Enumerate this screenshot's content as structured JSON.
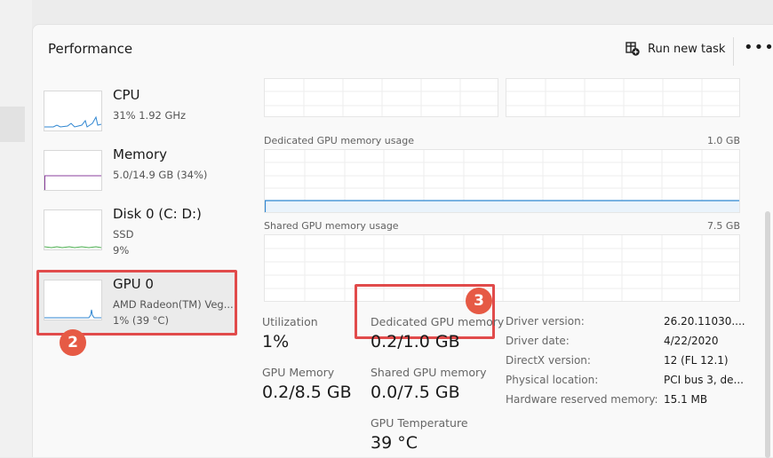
{
  "header": {
    "title": "Performance",
    "run_task_label": "Run new task",
    "more_label": "•••"
  },
  "sidebar": {
    "items": [
      {
        "title": "CPU",
        "line1": "31%  1.92 GHz",
        "line2": ""
      },
      {
        "title": "Memory",
        "line1": "5.0/14.9 GB (34%)",
        "line2": ""
      },
      {
        "title": "Disk 0 (C: D:)",
        "line1": "SSD",
        "line2": "9%"
      },
      {
        "title": "GPU 0",
        "line1": "AMD Radeon(TM) Veg...",
        "line2": "1% (39 °C)"
      }
    ]
  },
  "annotations": {
    "badge_2": "2",
    "badge_3": "3"
  },
  "graphs": {
    "dedicated": {
      "label": "Dedicated GPU memory usage",
      "max": "1.0 GB"
    },
    "shared": {
      "label": "Shared GPU memory usage",
      "max": "7.5 GB"
    }
  },
  "stats": {
    "utilization": {
      "label": "Utilization",
      "value": "1%"
    },
    "gpu_memory": {
      "label": "GPU Memory",
      "value": "0.2/8.5 GB"
    },
    "dedicated_memory": {
      "label": "Dedicated GPU memory",
      "value": "0.2/1.0 GB"
    },
    "shared_memory": {
      "label": "Shared GPU memory",
      "value": "0.0/7.5 GB"
    },
    "temperature": {
      "label": "GPU Temperature",
      "value": "39 °C"
    }
  },
  "info": [
    {
      "key": "Driver version:",
      "value": "26.20.11030...."
    },
    {
      "key": "Driver date:",
      "value": "4/22/2020"
    },
    {
      "key": "DirectX version:",
      "value": "12 (FL 12.1)"
    },
    {
      "key": "Physical location:",
      "value": "PCI bus 3, de..."
    },
    {
      "key": "Hardware reserved memory:",
      "value": "15.1 MB"
    }
  ],
  "colors": {
    "highlight_red": "#e14b4b",
    "badge": "#e65a45",
    "cpu_line": "#2f86d1",
    "memory_line": "#8a3f9c",
    "disk_line": "#4caf50",
    "gpu_line": "#2f86d1"
  }
}
